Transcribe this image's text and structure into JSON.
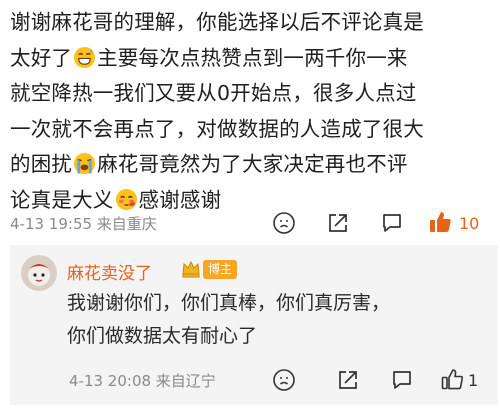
{
  "comment": {
    "lines": [
      [
        "谢谢麻花哥的理解，你能选择以后不评论真是"
      ],
      [
        "太好了",
        "主要每次点热赞点到一两千你一来"
      ],
      [
        "就空降热一我们又要从0开始点，很多人点过"
      ],
      [
        "一次就不会再点了，对做数据的人造成了很大"
      ],
      [
        "的困扰",
        "麻花哥竟然为了大家决定再也不评"
      ],
      [
        "论真是大义",
        "感谢感谢"
      ]
    ],
    "emoji_icons": [
      "grinning-sweat-emoji",
      "crying-emoji",
      "blushing-emoji"
    ],
    "meta": "4-13 19:55 来自重庆",
    "like_count": "10",
    "like_active": true,
    "accent_color": "#e8631a"
  },
  "reply": {
    "user_name": "麻花卖没了",
    "badge": "博主",
    "lines": [
      "我谢谢你们，你们真棒，你们真厉害，",
      "你们做数据太有耐心了"
    ],
    "meta": "4-13 20:08 来自辽宁",
    "like_count": "1"
  },
  "colors": {
    "accent": "#e8631a",
    "badge": "#f6a623",
    "meta": "#8a8a8a",
    "reply_bg": "#f4f4f4"
  }
}
